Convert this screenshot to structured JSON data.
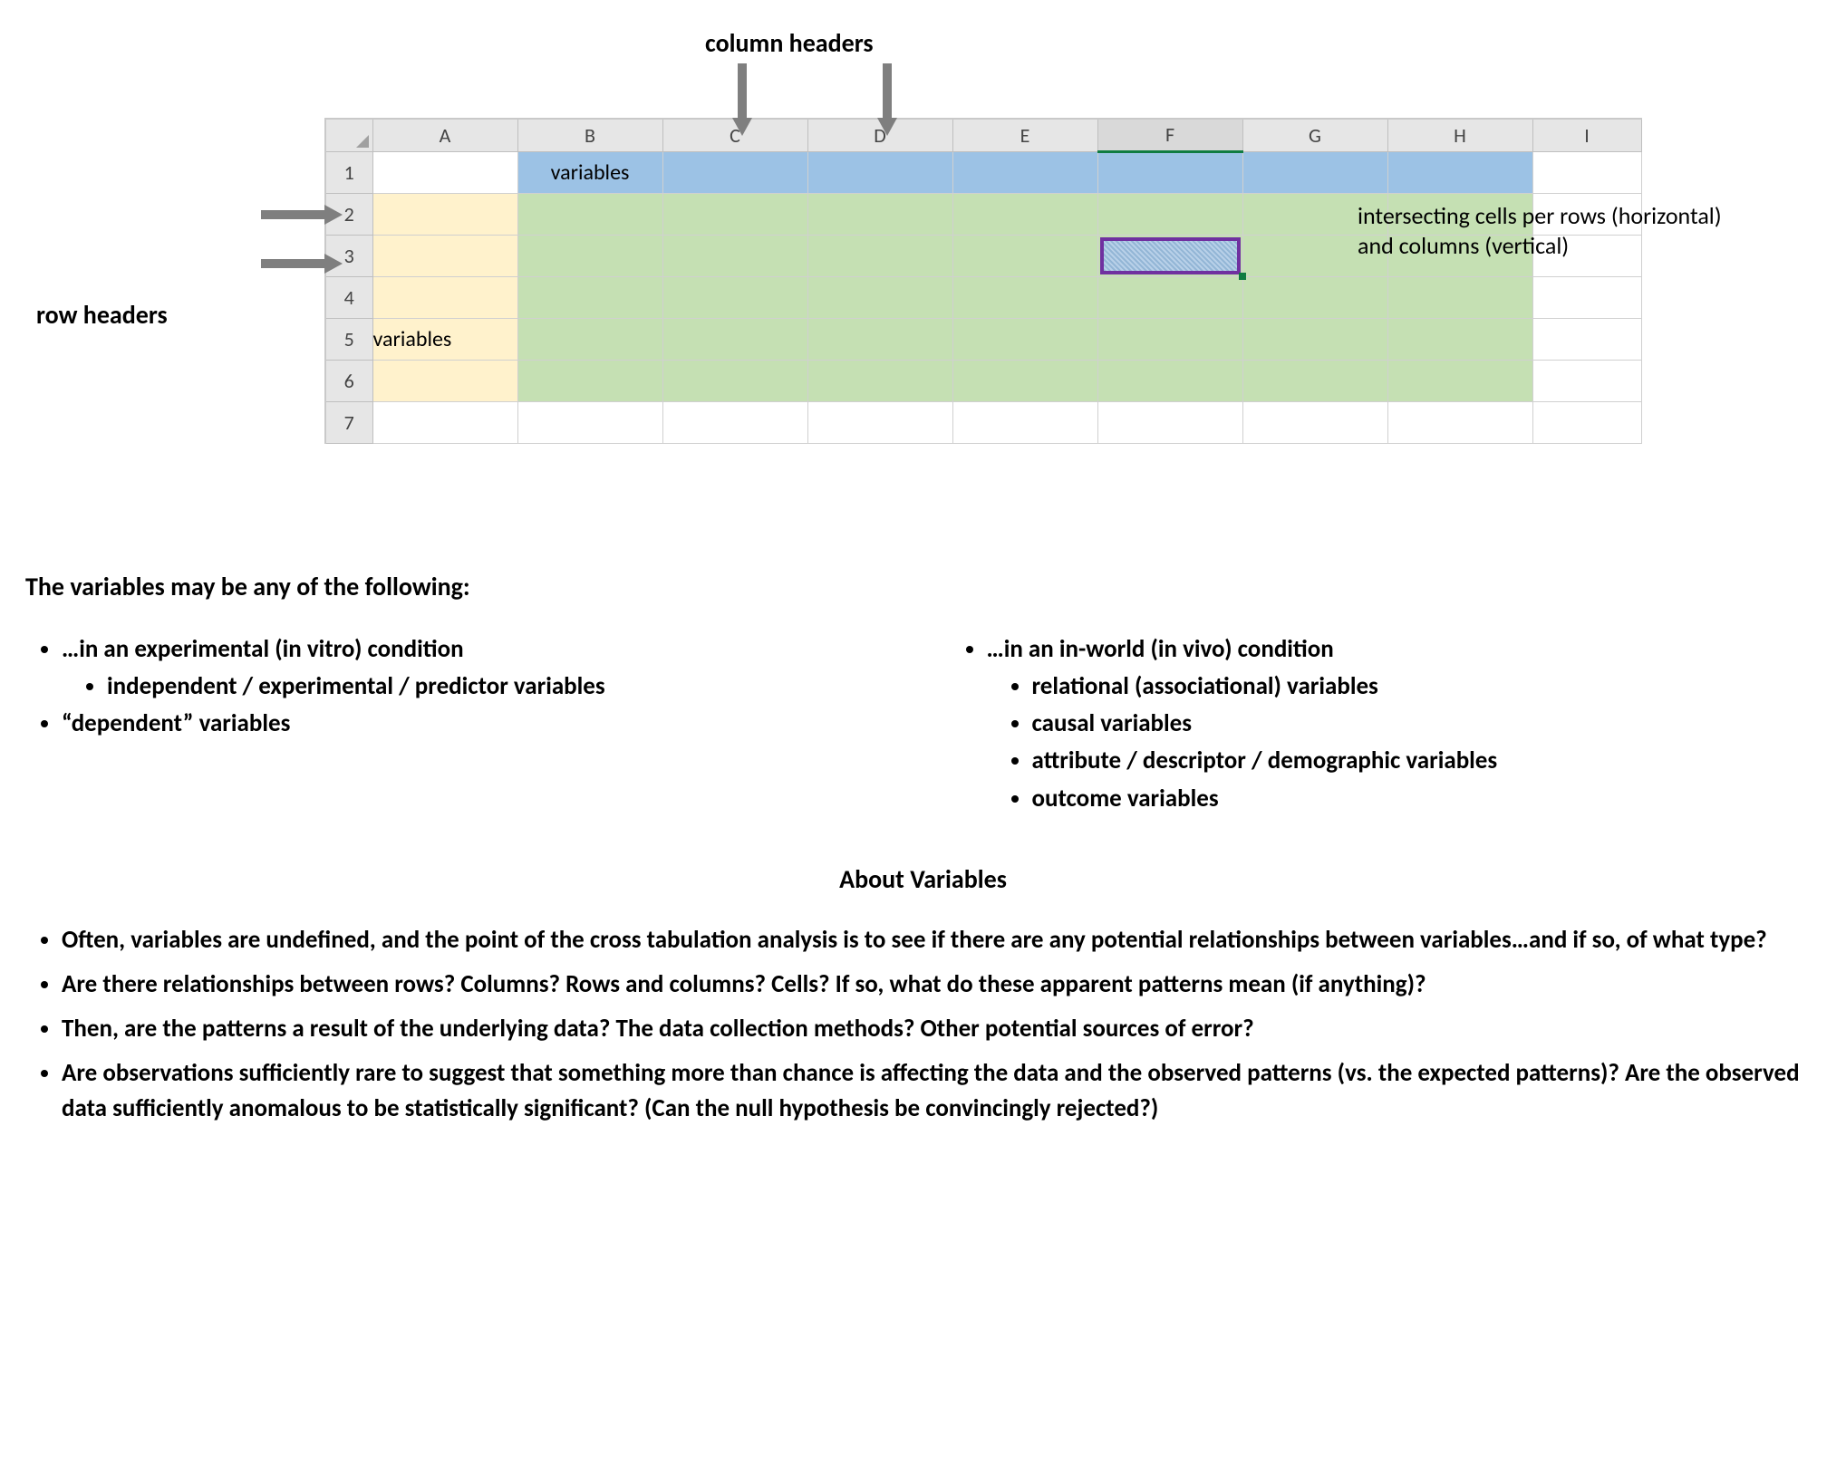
{
  "labels": {
    "column_headers": "column headers",
    "row_headers": "row headers",
    "intersect": "intersecting cells per rows (horizontal) and columns (vertical)"
  },
  "sheet": {
    "cols": [
      "A",
      "B",
      "C",
      "D",
      "E",
      "F",
      "G",
      "H",
      "I"
    ],
    "rows": [
      "1",
      "2",
      "3",
      "4",
      "5",
      "6",
      "7"
    ],
    "b1": "variables",
    "a5": "variables"
  },
  "text": {
    "intro": "The variables may be any of the following:",
    "left": {
      "l1": "…in an experimental (in vitro) condition",
      "l1a": "independent / experimental / predictor variables",
      "l2": "“dependent” variables"
    },
    "right": {
      "r1": "…in an in-world (in vivo) condition",
      "r1a": "relational (associational) variables",
      "r1b": "causal variables",
      "r1c": "attribute / descriptor / demographic variables",
      "r1d": "outcome variables"
    },
    "section_title": "About Variables",
    "about": [
      "Often, variables are undefined, and the point of the cross tabulation analysis is to see if there are any potential relationships between variables…and if so, of what type?",
      "Are there relationships between rows? Columns?  Rows and columns?  Cells?  If so, what do these apparent patterns mean (if anything)?",
      "Then, are the patterns a result of the underlying data? The data collection methods? Other potential sources of error?",
      "Are observations sufficiently rare to suggest that something more than chance is affecting the data and the observed patterns (vs. the expected patterns)?  Are the observed data sufficiently anomalous to be statistically significant?  (Can the null hypothesis be convincingly rejected?)"
    ]
  }
}
